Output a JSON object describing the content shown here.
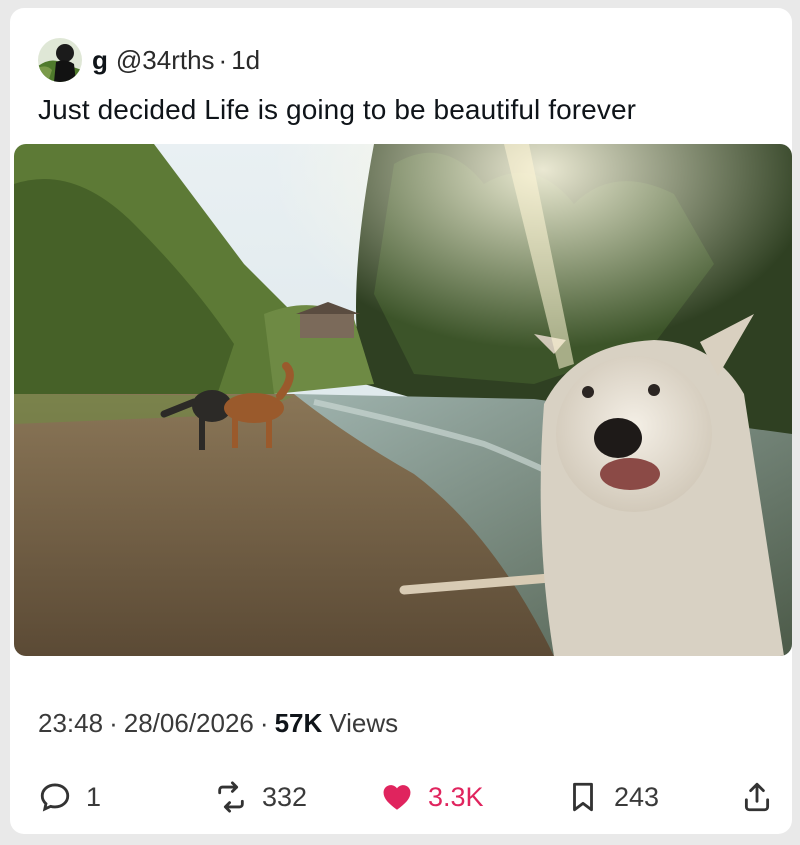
{
  "tweet": {
    "display_name": "g",
    "handle": "@34rths",
    "separator": "·",
    "age": "1d",
    "text": "Just decided Life is going to be beautiful forever"
  },
  "meta": {
    "time": "23:48",
    "date": "28/06/2026",
    "views_count": "57K",
    "views_label": "Views",
    "separator": "·"
  },
  "actions": {
    "replies": "1",
    "reposts": "332",
    "likes": "3.3K",
    "bookmarks": "243"
  },
  "colors": {
    "like": "#e0245e",
    "text": "#0f1419",
    "muted": "#3a3a3a"
  },
  "icons": [
    "reply-icon",
    "repost-icon",
    "heart-icon",
    "bookmark-icon",
    "share-icon"
  ]
}
